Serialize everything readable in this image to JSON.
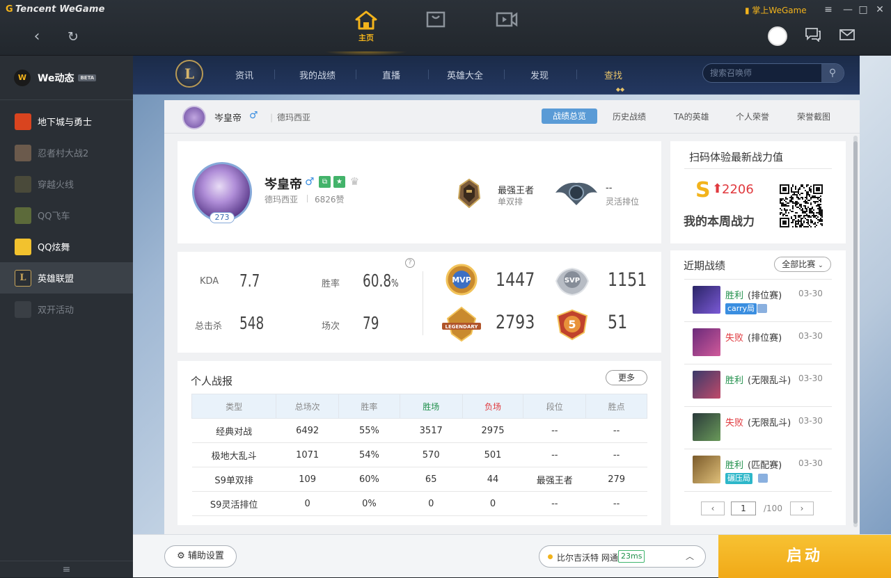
{
  "app": {
    "brand": "Tencent WeGame",
    "mobile_link": "掌上WeGame"
  },
  "top_tabs": {
    "home_label": "主页"
  },
  "sidebar": {
    "we_dynamic": "We动态",
    "beta": "BETA",
    "games": [
      {
        "label": "地下城与勇士",
        "dim": false
      },
      {
        "label": "忍者村大战2",
        "dim": true
      },
      {
        "label": "穿越火线",
        "dim": true
      },
      {
        "label": "QQ飞车",
        "dim": true
      },
      {
        "label": "QQ炫舞",
        "dim": false
      },
      {
        "label": "英雄联盟",
        "dim": false,
        "active": true
      },
      {
        "label": "双开活动",
        "dim": true
      }
    ]
  },
  "lol_nav": {
    "tabs": [
      "资讯",
      "我的战绩",
      "直播",
      "英雄大全",
      "发现",
      "查找"
    ],
    "active_tab": "查找",
    "search_placeholder": "搜索召唤师"
  },
  "subhead": {
    "name": "岑皇帝",
    "gender": "♂",
    "server": "德玛西亚",
    "tabs": [
      "战绩总览",
      "历史战绩",
      "TA的英雄",
      "个人荣誉",
      "荣誉截图"
    ],
    "active_tab": "战绩总览"
  },
  "profile": {
    "name": "岑皇帝",
    "gender": "♂",
    "level": "273",
    "server": "德玛西亚",
    "likes": "6826赞",
    "ranks": [
      {
        "title": "最强王者",
        "sub": "单双排"
      },
      {
        "title": "--",
        "sub": "灵活排位"
      }
    ]
  },
  "stats": {
    "kda_label": "KDA",
    "kda": "7.7",
    "winrate_label": "胜率",
    "winrate": "60.8",
    "winrate_unit": "%",
    "kills_label": "总击杀",
    "kills": "548",
    "games_label": "场次",
    "games": "79",
    "honors": [
      {
        "icon": "mvp-badge-icon",
        "value": "1447"
      },
      {
        "icon": "svp-badge-icon",
        "value": "1151"
      },
      {
        "icon": "legendary-badge-icon",
        "value": "2793"
      },
      {
        "icon": "pentakill-badge-icon",
        "value": "51"
      }
    ]
  },
  "report": {
    "title": "个人战报",
    "more": "更多",
    "headers": [
      "类型",
      "总场次",
      "胜率",
      "胜场",
      "负场",
      "段位",
      "胜点"
    ],
    "rows": [
      [
        "经典对战",
        "6492",
        "55%",
        "3517",
        "2975",
        "--",
        "--"
      ],
      [
        "极地大乱斗",
        "1071",
        "54%",
        "570",
        "501",
        "--",
        "--"
      ],
      [
        "S9单双排",
        "109",
        "60%",
        "65",
        "44",
        "最强王者",
        "279"
      ],
      [
        "S9灵活排位",
        "0",
        "0%",
        "0",
        "0",
        "--",
        "--"
      ]
    ]
  },
  "qr": {
    "title": "扫码体验最新战力值",
    "score": "2206",
    "weekly": "我的本周战力"
  },
  "recent": {
    "title": "近期战绩",
    "filter": "全部比赛",
    "matches": [
      {
        "result": "胜利",
        "win": true,
        "mode": "(排位赛)",
        "date": "03-30",
        "tag": "carry局",
        "tag_color": "#3a8ee0"
      },
      {
        "result": "失败",
        "win": false,
        "mode": "(排位赛)",
        "date": "03-30"
      },
      {
        "result": "胜利",
        "win": true,
        "mode": "(无限乱斗)",
        "date": "03-30"
      },
      {
        "result": "失败",
        "win": false,
        "mode": "(无限乱斗)",
        "date": "03-30"
      },
      {
        "result": "胜利",
        "win": true,
        "mode": "(匹配赛)",
        "date": "03-30",
        "tag": "碾压局",
        "tag_color": "#2db7c9"
      }
    ],
    "page": "1",
    "total": "/100"
  },
  "bottom": {
    "assist": "辅助设置",
    "server": "比尔吉沃特 网通",
    "ping": "23ms",
    "launch": "启动"
  },
  "colors": {
    "accent": "#f2b31c",
    "win": "#1f8f4a",
    "loss": "#e0393e"
  }
}
